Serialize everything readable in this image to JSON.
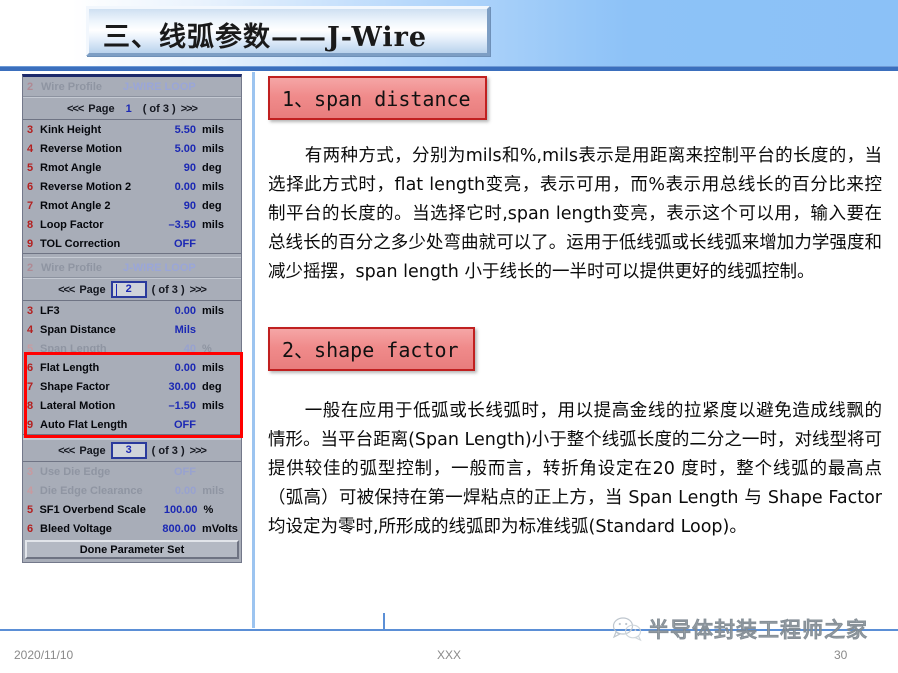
{
  "slide": {
    "title": "三、线弧参数——J-Wire"
  },
  "footer": {
    "date": "2020/11/10",
    "center": "XXX",
    "page_number": "30",
    "watermark_text": "半导体封装工程师之家",
    "watermark_icon": "wechat-icon"
  },
  "colors": {
    "header_blue": "#8bc1f7",
    "rule_blue": "#3b6fbd",
    "panel_gray": "#a8adb8",
    "panel_value_blue": "#1b28b4",
    "panel_index_red": "#b32020",
    "highlight_red": "#ff0000",
    "heading_red": "#e87d7d",
    "footer_gray": "#8a8a8a"
  },
  "panel": {
    "pages": [
      {
        "profile": {
          "index": "2",
          "label": "Wire Profile",
          "value": "J-WIRE LOOP"
        },
        "pager": {
          "prev": "<<<",
          "word": "Page",
          "number": "1",
          "of": "( of 3 )",
          "next": ">>>",
          "boxed": false,
          "caret": false
        },
        "rows": [
          {
            "index": "3",
            "name": "Kink Height",
            "value": "5.50",
            "unit": "mils",
            "dim": false
          },
          {
            "index": "4",
            "name": "Reverse Motion",
            "value": "5.00",
            "unit": "mils",
            "dim": false
          },
          {
            "index": "5",
            "name": "Rmot Angle",
            "value": "90",
            "unit": "deg",
            "dim": false
          },
          {
            "index": "6",
            "name": "Reverse Motion 2",
            "value": "0.00",
            "unit": "mils",
            "dim": false
          },
          {
            "index": "7",
            "name": "Rmot Angle 2",
            "value": "90",
            "unit": "deg",
            "dim": false
          },
          {
            "index": "8",
            "name": "Loop Factor",
            "value": "–3.50",
            "unit": "mils",
            "dim": false
          },
          {
            "index": "9",
            "name": "TOL Correction",
            "value": "OFF",
            "unit": "",
            "dim": false
          }
        ]
      },
      {
        "profile": {
          "index": "2",
          "label": "Wire Profile",
          "value": "J-WIRE LOOP"
        },
        "pager": {
          "prev": "<<<",
          "word": "Page",
          "number": "2",
          "of": "( of 3 )",
          "next": ">>>",
          "boxed": true,
          "caret": true
        },
        "rows": [
          {
            "index": "3",
            "name": "LF3",
            "value": "0.00",
            "unit": "mils",
            "dim": false
          },
          {
            "index": "4",
            "name": "Span Distance",
            "value": "Mils",
            "unit": "",
            "dim": false
          },
          {
            "index": "5",
            "name": "Span Length",
            "value": "40",
            "unit": "%",
            "dim": true
          },
          {
            "index": "6",
            "name": "Flat Length",
            "value": "0.00",
            "unit": "mils",
            "dim": false
          },
          {
            "index": "7",
            "name": "Shape Factor",
            "value": "30.00",
            "unit": "deg",
            "dim": false
          },
          {
            "index": "8",
            "name": "Lateral Motion",
            "value": "–1.50",
            "unit": "mils",
            "dim": false
          },
          {
            "index": "9",
            "name": "Auto Flat Length",
            "value": "OFF",
            "unit": "",
            "dim": false
          }
        ]
      },
      {
        "profile": null,
        "pager": {
          "prev": "<<<",
          "word": "Page",
          "number": "3",
          "of": "( of 3 )",
          "next": ">>>",
          "boxed": true,
          "caret": false
        },
        "rows": [
          {
            "index": "3",
            "name": "Use Die Edge",
            "value": "OFF",
            "unit": "",
            "dim": true
          },
          {
            "index": "4",
            "name": "Die Edge Clearance",
            "value": "0.00",
            "unit": "mils",
            "dim": true
          },
          {
            "index": "5",
            "name": "SF1 Overbend Scale",
            "value": "100.00",
            "unit": "%",
            "dim": false
          },
          {
            "index": "6",
            "name": "Bleed Voltage",
            "value": "800.00",
            "unit": "mVolts",
            "dim": false
          }
        ]
      }
    ],
    "done_button": "Done Parameter Set"
  },
  "content": {
    "section_1": {
      "heading": "1、span distance",
      "paragraph": "有两种方式，分别为mils和%,mils表示是用距离来控制平台的长度的，当选择此方式时，flat length变亮，表示可用，而%表示用总线长的百分比来控制平台的长度的。当选择它时,span length变亮，表示这个可以用，输入要在总线长的百分之多少处弯曲就可以了。运用于低线弧或长线弧来增加力学强度和减少摇摆，span length 小于线长的一半时可以提供更好的线弧控制。"
    },
    "section_2": {
      "heading": "2、shape factor",
      "paragraph": "一般在应用于低弧或长线弧时，用以提高金线的拉紧度以避免造成线飘的情形。当平台距离(Span Length)小于整个线弧长度的二分之一时，对线型将可提供较佳的弧型控制，一般而言，转折角设定在20 度时，整个线弧的最高点（弧高）可被保持在第一焊粘点的正上方，当 Span Length 与 Shape Factor 均设定为零时,所形成的线弧即为标准线弧(Standard Loop)。"
    }
  }
}
